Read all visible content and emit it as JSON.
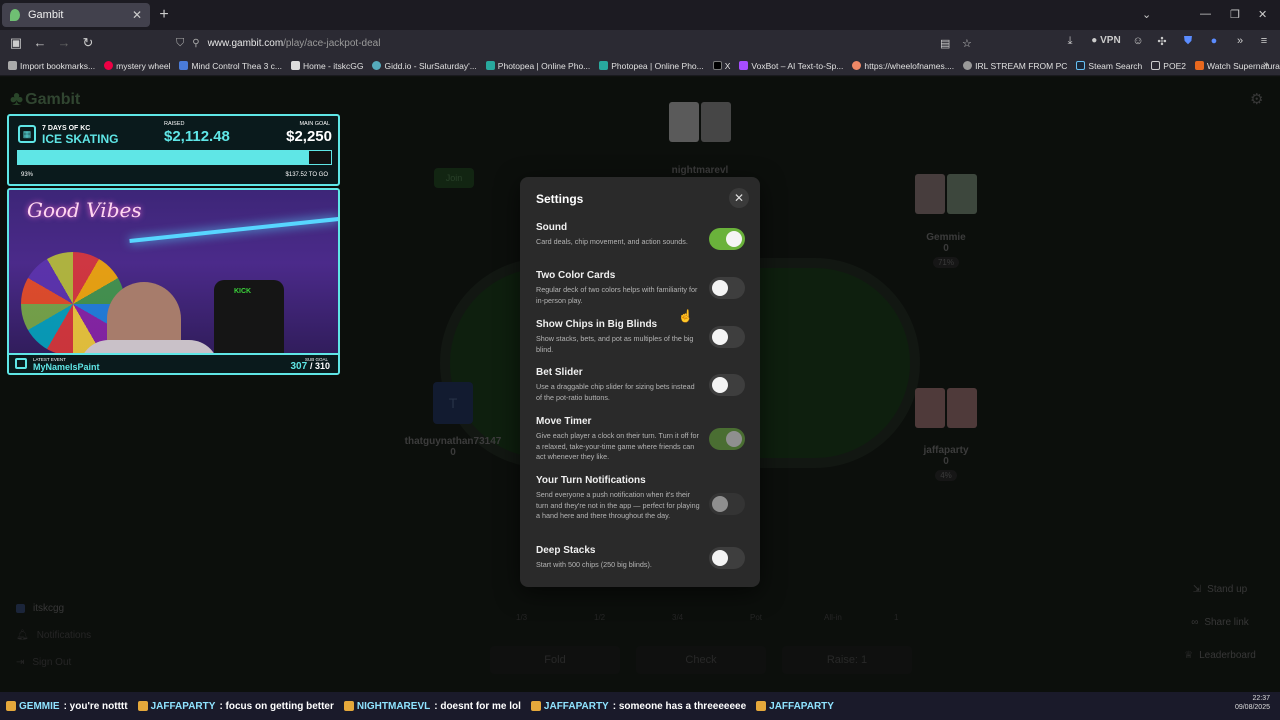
{
  "browser": {
    "tab_title": "Gambit",
    "new_tab": "+",
    "url_domain": "www.gambit.com",
    "url_path": "/play/ace-jackpot-deal",
    "vpn_label": "VPN",
    "bookmarks": [
      "Import bookmarks...",
      "mystery wheel",
      "Mind Control Thea 3 c...",
      "Home - itskcGG",
      "Gidd.io - SlurSaturday'...",
      "Photopea | Online Pho...",
      "Photopea | Online Pho...",
      "X",
      "VoxBot – AI Text-to-Sp...",
      "https://wheelofnames....",
      "IRL STREAM FROM PC",
      "Steam Search",
      "POE2",
      "Watch Supernatural - ..."
    ]
  },
  "app": {
    "logo": "Gambit",
    "join_label": "Join",
    "seats": [
      {
        "name": "nightmarevl",
        "stack": ""
      },
      {
        "name": "Gemmie",
        "stack": "0",
        "pct": "71%"
      },
      {
        "name": "thatguynathan73147",
        "stack": "0"
      },
      {
        "name": "jaffaparty",
        "stack": "0",
        "pct": "4%"
      }
    ],
    "sidebar": {
      "user": "itskcgg",
      "notifications": "Notifications",
      "sign_out": "Sign Out"
    },
    "right_actions": {
      "stand_up": "Stand up",
      "share_link": "Share link",
      "leaderboard": "Leaderboard"
    },
    "bet_options": [
      "1/3",
      "1/2",
      "3/4",
      "Pot",
      "All-in",
      "1"
    ],
    "actions": {
      "fold": "Fold",
      "check": "Check",
      "raise": "Raise: 1"
    }
  },
  "overlay": {
    "goal_days": "7 DAYS OF KC",
    "goal_name": "ICE SKATING",
    "raised_label": "RAISED",
    "raised_value": "$2,112.48",
    "main_goal_label": "MAIN GOAL",
    "main_goal_value": "$2,250",
    "progress_percent": 93,
    "progress_label": "93%",
    "to_go": "$137.52 TO GO",
    "neon_sign": "Good Vibes",
    "chair_brand": "KICK",
    "latest_event_label": "LATEST EVENT",
    "latest_event_name": "MyNameIsPaint",
    "sub_goal_label": "SUB GOAL",
    "sub_goal_current": "307",
    "sub_goal_target": "/ 310"
  },
  "settings": {
    "title": "Settings",
    "items": [
      {
        "title": "Sound",
        "desc": "Card deals, chip movement, and action sounds.",
        "enabled": true
      },
      {
        "title": "Two Color Cards",
        "desc": "Regular deck of two colors helps with familiarity for in-person play.",
        "enabled": false
      },
      {
        "title": "Show Chips in Big Blinds",
        "desc": "Show stacks, bets, and pot as multiples of the big blind.",
        "enabled": false
      },
      {
        "title": "Bet Slider",
        "desc": "Use a draggable chip slider for sizing bets instead of the pot-ratio buttons.",
        "enabled": false
      },
      {
        "title": "Move Timer",
        "desc": "Give each player a clock on their turn. Turn it off for a relaxed, take-your-time game where friends can act whenever they like.",
        "enabled": true
      },
      {
        "title": "Your Turn Notifications",
        "desc": "Send everyone a push notification when it's their turn and they're not in the app — perfect for playing a hand here and there throughout the day.",
        "enabled": false
      },
      {
        "title": "Deep Stacks",
        "desc": "Start with 500 chips (250 big blinds).",
        "enabled": false
      }
    ]
  },
  "ticker": [
    {
      "user": "GEMMIE",
      "msg": ": you're notttt"
    },
    {
      "user": "JAFFAPARTY",
      "msg": ": focus on getting better"
    },
    {
      "user": "NIGHTMAREVL",
      "msg": ": doesnt for me lol"
    },
    {
      "user": "JAFFAPARTY",
      "msg": ": someone has a threeeeeee"
    },
    {
      "user": "JAFFAPARTY",
      "msg": ""
    }
  ],
  "clock": {
    "time": "22:37",
    "date": "09/08/2025"
  }
}
